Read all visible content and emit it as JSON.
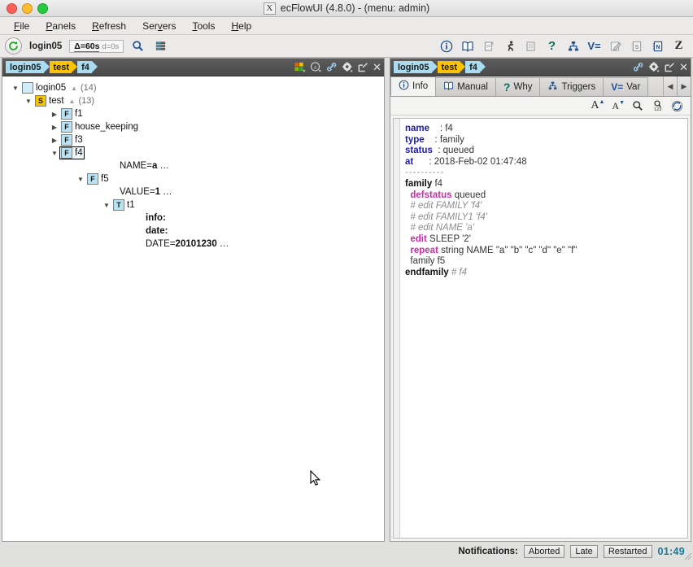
{
  "window": {
    "title": "ecFlowUI (4.8.0) - (menu: admin)",
    "x_logo": "X",
    "traffic": [
      "close",
      "minimize",
      "zoom"
    ]
  },
  "menubar": {
    "items": [
      {
        "label": "File",
        "mnemonic": "F"
      },
      {
        "label": "Panels",
        "mnemonic": "P"
      },
      {
        "label": "Refresh",
        "mnemonic": "R"
      },
      {
        "label": "Servers",
        "mnemonic": "v"
      },
      {
        "label": "Tools",
        "mnemonic": "T"
      },
      {
        "label": "Help",
        "mnemonic": "H"
      }
    ]
  },
  "toolbar": {
    "refresh_icon": "refresh-icon",
    "server_name": "login05",
    "delta_label": "Δ=60s",
    "delta_sub": "d=0s",
    "search_icon": "search-icon",
    "servers_icon": "server-stack-icon",
    "right_icons": [
      {
        "name": "info-icon",
        "glyph": "ⓘ"
      },
      {
        "name": "manual-book-icon",
        "glyph": "📖"
      },
      {
        "name": "script-icon",
        "glyph": "📜"
      },
      {
        "name": "job-runner-icon",
        "glyph": "🏃"
      },
      {
        "name": "output-printer-icon",
        "glyph": "🖶"
      },
      {
        "name": "why-question-icon",
        "glyph": "?"
      },
      {
        "name": "triggers-icon",
        "glyph": "⑂"
      },
      {
        "name": "variables-icon",
        "glyph": "V="
      },
      {
        "name": "edit-pencil-icon",
        "glyph": "✎"
      },
      {
        "name": "suite-s-icon",
        "glyph": "S"
      },
      {
        "name": "node-n-icon",
        "glyph": "N"
      },
      {
        "name": "zombie-z-icon",
        "glyph": "Z"
      }
    ]
  },
  "left_panel": {
    "breadcrumb": [
      {
        "label": "login05",
        "selected": false
      },
      {
        "label": "test",
        "selected": true
      },
      {
        "label": "f4",
        "selected": false
      }
    ],
    "header_icons": [
      {
        "name": "status-filter-icon",
        "glyph": "■"
      },
      {
        "name": "attribute-filter-icon",
        "glyph": "ⓐ"
      },
      {
        "name": "link-icon",
        "glyph": "🔗"
      },
      {
        "name": "gear-icon",
        "glyph": "⚙"
      },
      {
        "name": "detach-icon",
        "glyph": "↗"
      },
      {
        "name": "close-icon",
        "glyph": "✕"
      }
    ],
    "tree": [
      {
        "depth": 0,
        "arrow": "down",
        "badge": "",
        "badge_kind": "blank",
        "label": "login05",
        "count": "(14)",
        "tri": true,
        "selected": false,
        "type": "server"
      },
      {
        "depth": 1,
        "arrow": "down",
        "badge": "S",
        "badge_kind": "s",
        "label": "test",
        "count": "(13)",
        "tri": true,
        "selected": false,
        "type": "suite"
      },
      {
        "depth": 2,
        "arrow": "right",
        "badge": "F",
        "badge_kind": "f",
        "label": "f1",
        "count": "",
        "tri": false,
        "selected": false,
        "type": "family"
      },
      {
        "depth": 2,
        "arrow": "right",
        "badge": "F",
        "badge_kind": "f",
        "label": "house_keeping",
        "count": "",
        "tri": false,
        "selected": false,
        "type": "family"
      },
      {
        "depth": 2,
        "arrow": "right",
        "badge": "F",
        "badge_kind": "f",
        "label": "f3",
        "count": "",
        "tri": false,
        "selected": false,
        "type": "family"
      },
      {
        "depth": 2,
        "arrow": "down",
        "badge": "F",
        "badge_kind": "f",
        "label": "f4",
        "count": "",
        "tri": false,
        "selected": true,
        "type": "family"
      },
      {
        "depth": 4,
        "arrow": "",
        "badge": null,
        "label": "NAME=",
        "value": "a",
        "ellipsis": " …",
        "type": "attribute"
      },
      {
        "depth": 3,
        "arrow": "down",
        "badge": "F",
        "badge_kind": "f",
        "label": "f5",
        "count": "",
        "tri": false,
        "selected": false,
        "type": "family"
      },
      {
        "depth": 5,
        "arrow": "",
        "badge": null,
        "label": "VALUE=",
        "value": "1",
        "ellipsis": " …",
        "type": "attribute"
      },
      {
        "depth": 4,
        "arrow": "down",
        "badge": "T",
        "badge_kind": "t",
        "label": "t1",
        "count": "",
        "tri": false,
        "selected": false,
        "type": "task"
      },
      {
        "depth": 6,
        "arrow": "",
        "badge": null,
        "label": "",
        "value": "info:",
        "ellipsis": "",
        "type": "attribute"
      },
      {
        "depth": 6,
        "arrow": "",
        "badge": null,
        "label": "",
        "value": "date:",
        "ellipsis": "",
        "type": "attribute"
      },
      {
        "depth": 6,
        "arrow": "",
        "badge": null,
        "label": "DATE=",
        "value": "20101230",
        "ellipsis": " …",
        "type": "attribute"
      }
    ]
  },
  "right_panel": {
    "breadcrumb": [
      {
        "label": "login05",
        "selected": false
      },
      {
        "label": "test",
        "selected": true
      },
      {
        "label": "f4",
        "selected": false
      }
    ],
    "header_icons": [
      {
        "name": "link-icon",
        "glyph": "🔗"
      },
      {
        "name": "gear-icon",
        "glyph": "⚙"
      },
      {
        "name": "detach-icon",
        "glyph": "↗"
      },
      {
        "name": "close-icon",
        "glyph": "✕"
      }
    ],
    "tabs": [
      {
        "label": "Info",
        "icon": "info-icon",
        "glyph": "ⓘ",
        "active": true
      },
      {
        "label": "Manual",
        "icon": "manual-book-icon",
        "glyph": "📖",
        "active": false
      },
      {
        "label": "Why",
        "icon": "why-question-icon",
        "glyph": "?",
        "active": false
      },
      {
        "label": "Triggers",
        "icon": "triggers-icon",
        "glyph": "⑂",
        "active": false
      },
      {
        "label": "Var",
        "icon": "variables-icon",
        "glyph": "V=",
        "active": false
      }
    ],
    "tab_nav": {
      "prev": "◀",
      "next": "▶"
    },
    "info_tools": [
      {
        "name": "font-increase-icon",
        "glyph": "A",
        "sup": "▲"
      },
      {
        "name": "font-decrease-icon",
        "glyph": "A",
        "sup": "▼"
      },
      {
        "name": "search-icon",
        "glyph": "🔍",
        "sup": ""
      },
      {
        "name": "line-number-icon",
        "glyph": "🔍",
        "sup": "123"
      },
      {
        "name": "reload-icon",
        "glyph": "↻",
        "sup": ""
      }
    ],
    "info": {
      "fields": [
        {
          "key": "name",
          "value": "f4"
        },
        {
          "key": "type",
          "value": "family"
        },
        {
          "key": "status",
          "value": "queued"
        },
        {
          "key": "at",
          "value": "2018-Feb-02 01:47:48"
        }
      ],
      "separator": "----------",
      "definition": [
        {
          "indent": 0,
          "bold": "family",
          "rest": " f4",
          "style": "def"
        },
        {
          "indent": 2,
          "bold": "defstatus",
          "rest": " queued",
          "style": "kw"
        },
        {
          "indent": 2,
          "bold": "",
          "rest": "# edit FAMILY 'f4'",
          "style": "comment"
        },
        {
          "indent": 2,
          "bold": "",
          "rest": "# edit FAMILY1 'f4'",
          "style": "comment"
        },
        {
          "indent": 2,
          "bold": "",
          "rest": "# edit NAME 'a'",
          "style": "comment"
        },
        {
          "indent": 2,
          "bold": "edit",
          "rest": " SLEEP '2'",
          "style": "kw"
        },
        {
          "indent": 2,
          "bold": "repeat",
          "rest": " string NAME \"a\" \"b\" \"c\" \"d\" \"e\" \"f\"",
          "style": "kw"
        },
        {
          "indent": 2,
          "bold": "",
          "rest": "family f5",
          "style": "plain"
        },
        {
          "indent": 0,
          "bold": "endfamily",
          "rest": " # f4",
          "style": "end"
        }
      ]
    }
  },
  "statusbar": {
    "notifications_label": "Notifications:",
    "buttons": [
      "Aborted",
      "Late",
      "Restarted"
    ],
    "clock": "01:49"
  },
  "colors": {
    "crumb_normal": "#a9dcf0",
    "crumb_selected": "#fdc300",
    "badge_family": "#b7e3f2",
    "badge_suspended": "#f5c400",
    "info_key": "#1d1da8",
    "info_keyword": "#cc2aa8",
    "info_comment": "#8d8d8d",
    "clock": "#1a7a9a",
    "accent_blue": "#1d4f91"
  }
}
